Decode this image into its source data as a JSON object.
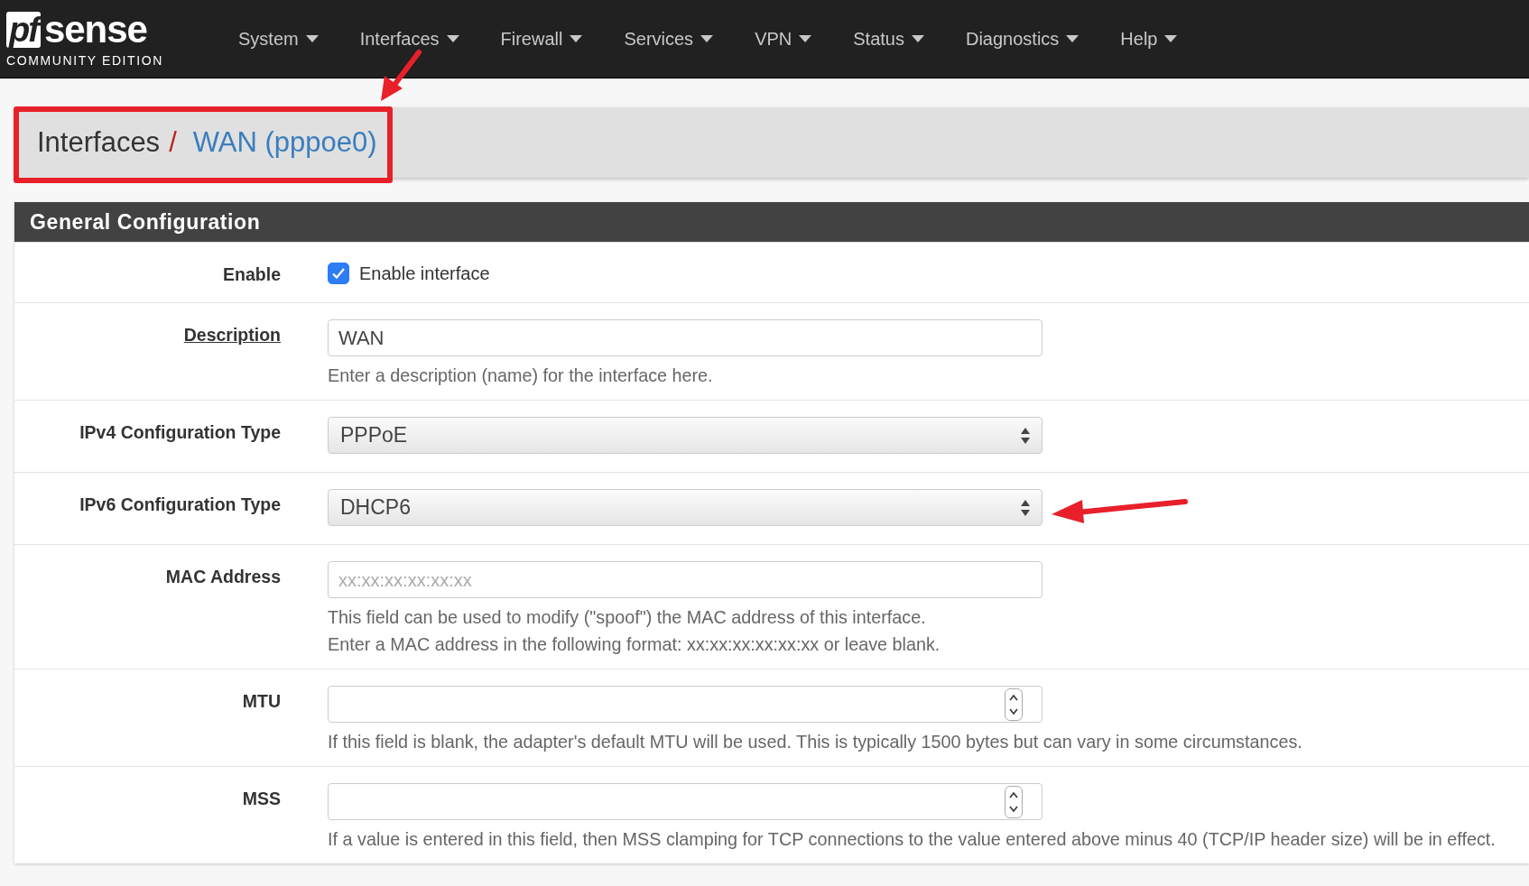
{
  "brand": {
    "mark": "pf",
    "name": "sense",
    "edition": "COMMUNITY EDITION"
  },
  "nav": [
    {
      "label": "System"
    },
    {
      "label": "Interfaces"
    },
    {
      "label": "Firewall"
    },
    {
      "label": "Services"
    },
    {
      "label": "VPN"
    },
    {
      "label": "Status"
    },
    {
      "label": "Diagnostics"
    },
    {
      "label": "Help"
    }
  ],
  "breadcrumb": {
    "parent": "Interfaces",
    "separator": "/",
    "current": "WAN (pppoe0)"
  },
  "panel": {
    "title": "General Configuration",
    "rows": [
      {
        "kind": "checkbox",
        "label": "Enable",
        "checked": true,
        "text": "Enable interface"
      },
      {
        "kind": "text",
        "label": "Description",
        "label_link": true,
        "value": "WAN",
        "help": [
          "Enter a description (name) for the interface here."
        ]
      },
      {
        "kind": "select",
        "label": "IPv4 Configuration Type",
        "value": "PPPoE"
      },
      {
        "kind": "select",
        "label": "IPv6 Configuration Type",
        "value": "DHCP6"
      },
      {
        "kind": "text",
        "label": "MAC Address",
        "placeholder": "xx:xx:xx:xx:xx:xx",
        "help": [
          "This field can be used to modify (\"spoof\") the MAC address of this interface.",
          "Enter a MAC address in the following format: xx:xx:xx:xx:xx:xx or leave blank."
        ]
      },
      {
        "kind": "number",
        "label": "MTU",
        "help": [
          "If this field is blank, the adapter's default MTU will be used. This is typically 1500 bytes but can vary in some circumstances."
        ]
      },
      {
        "kind": "number",
        "label": "MSS",
        "help": [
          "If a value is entered in this field, then MSS clamping for TCP connections to the value entered above minus 40 (TCP/IP header size) will be in effect."
        ]
      }
    ]
  }
}
